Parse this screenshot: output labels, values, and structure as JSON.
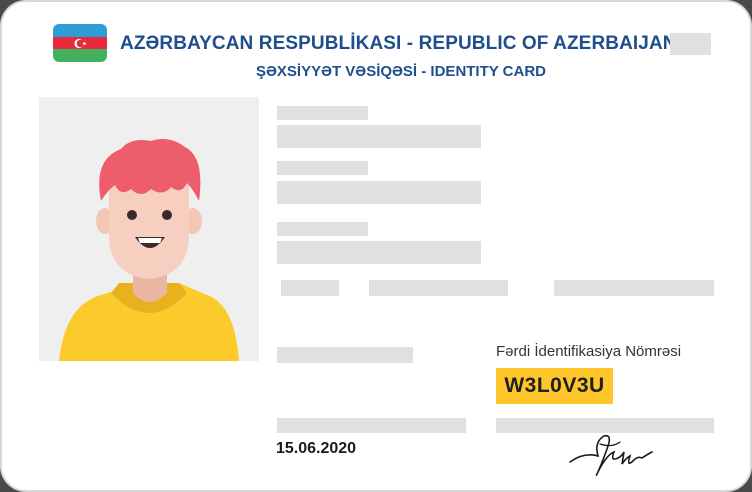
{
  "header": {
    "title": "AZƏRBAYCAN RESPUBLİKASI - REPUBLIC OF AZERBAIJAN",
    "subtitle": "ŞƏXSİYYƏT VƏSİQƏSİ - IDENTITY CARD",
    "flag_icon": "azerbaijan-flag-icon"
  },
  "colors": {
    "title": "#1f4e8c",
    "fin_badge": "#ffc62b",
    "placeholder": "#e0e0e0",
    "flag_blue": "#2e9dd5",
    "flag_red": "#e8293b",
    "flag_green": "#43b05c"
  },
  "fin": {
    "label": "Fərdi İdentifikasiya Nömrəsi",
    "value": "W3L0V3U"
  },
  "issue_date": "15.06.2020",
  "photo": {
    "icon": "person-avatar-illustration"
  },
  "signature": {
    "icon": "handwritten-signature"
  }
}
